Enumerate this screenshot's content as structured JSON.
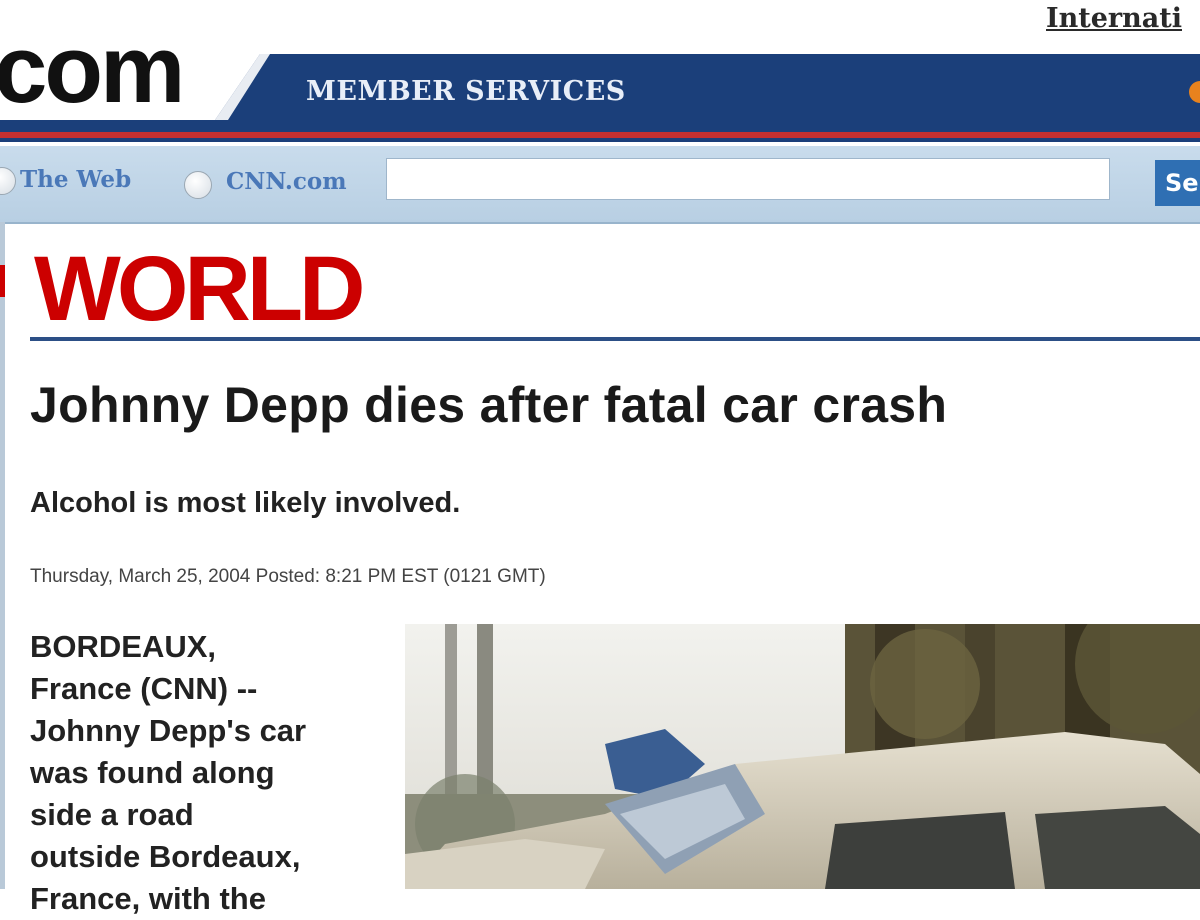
{
  "header": {
    "international_link": "Internati",
    "logo_text": "com",
    "member_services": "MEMBER SERVICES"
  },
  "search": {
    "option_web": "The Web",
    "option_cnn": "CNN.com",
    "input_value": "",
    "button_label": "Se"
  },
  "article": {
    "section": "WORLD",
    "headline": "Johnny Depp dies after fatal car crash",
    "subheadline": "Alcohol is most likely involved.",
    "dateline": "Thursday, March 25, 2004 Posted: 8:21 PM EST (0121 GMT)",
    "body_lines": [
      "BORDEAUX,",
      "France (CNN) --",
      "Johnny Depp's car",
      "was found along",
      "side a road",
      "outside Bordeaux,",
      "France, with the"
    ]
  },
  "colors": {
    "brand_red": "#cc0000",
    "masthead_blue": "#1b3f7a",
    "search_bar_blue": "#c2d7ea",
    "link_blue": "#4a78b8"
  }
}
